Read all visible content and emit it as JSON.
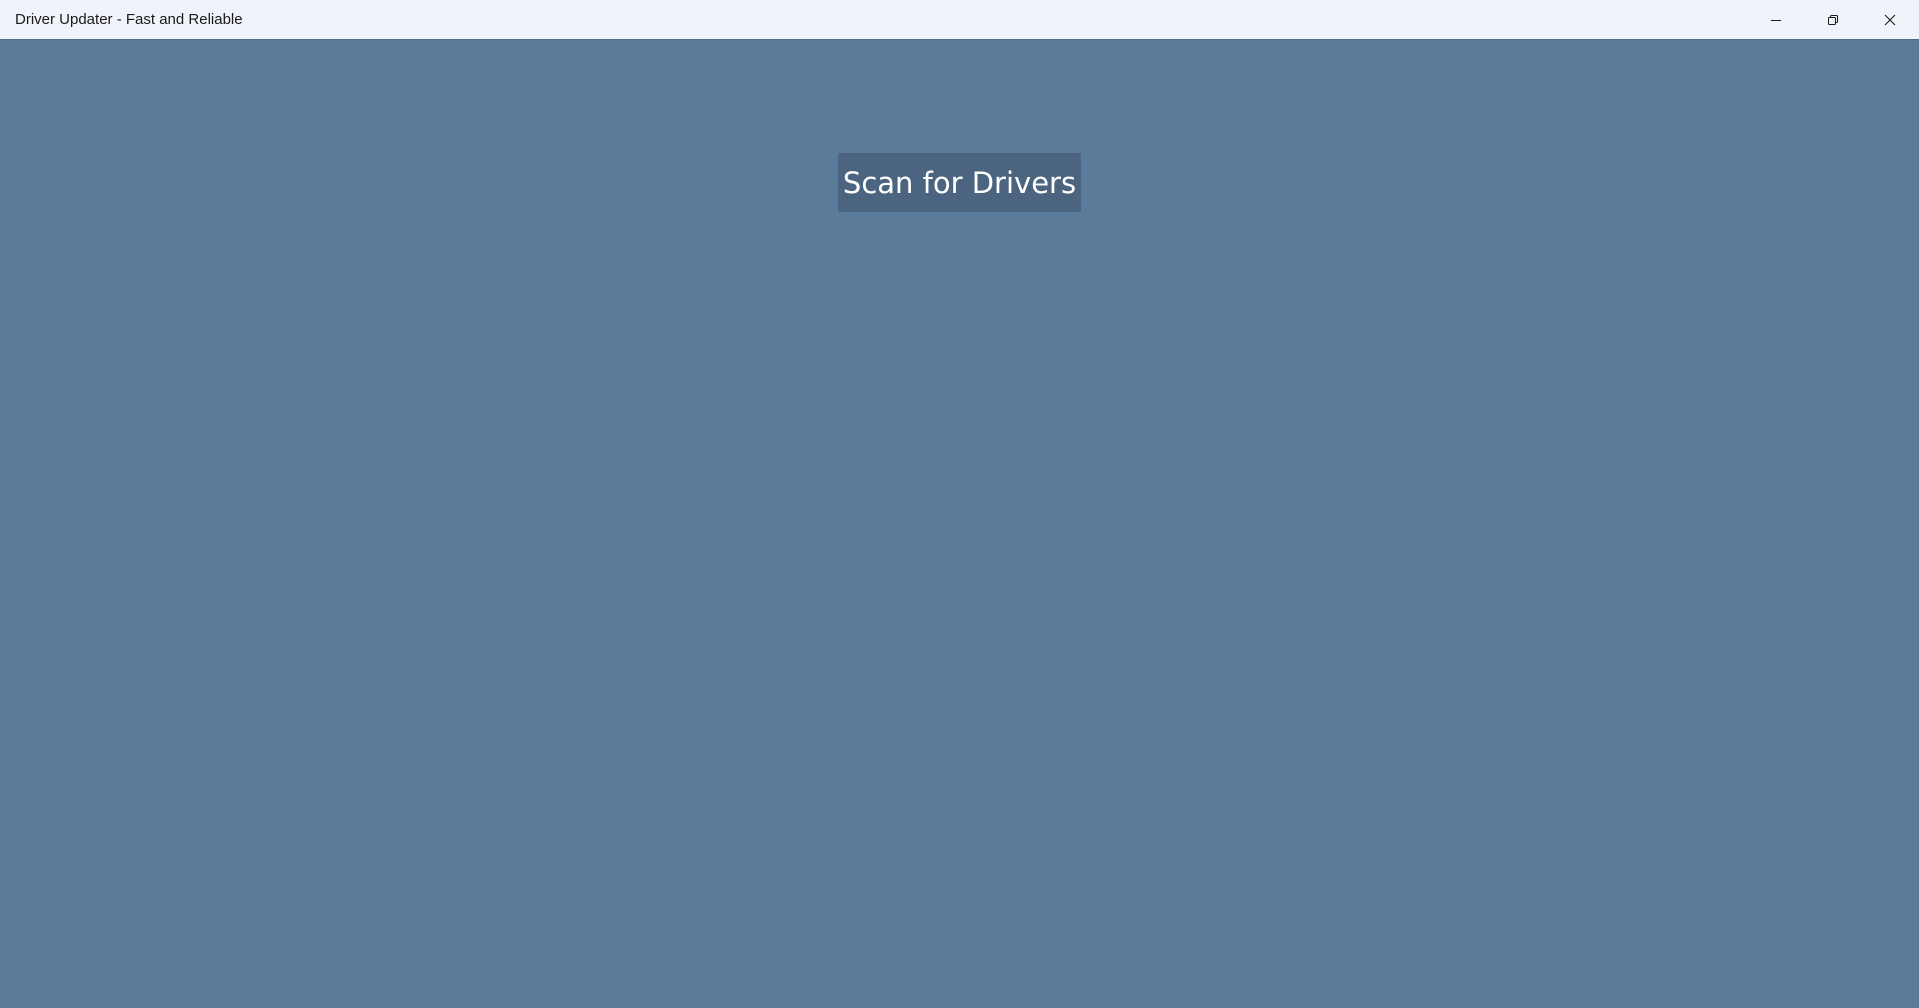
{
  "window": {
    "title": "Driver Updater - Fast and Reliable",
    "controls": {
      "minimize_icon": "minimize-icon",
      "maximize_icon": "restore-icon",
      "close_icon": "close-icon"
    }
  },
  "main": {
    "scan_button_label": "Scan for Drivers"
  },
  "colors": {
    "titlebar_bg": "#f0f3f9",
    "content_bg": "#5b7b9b",
    "button_bg": "#4b6580",
    "button_text": "#ffffff"
  }
}
